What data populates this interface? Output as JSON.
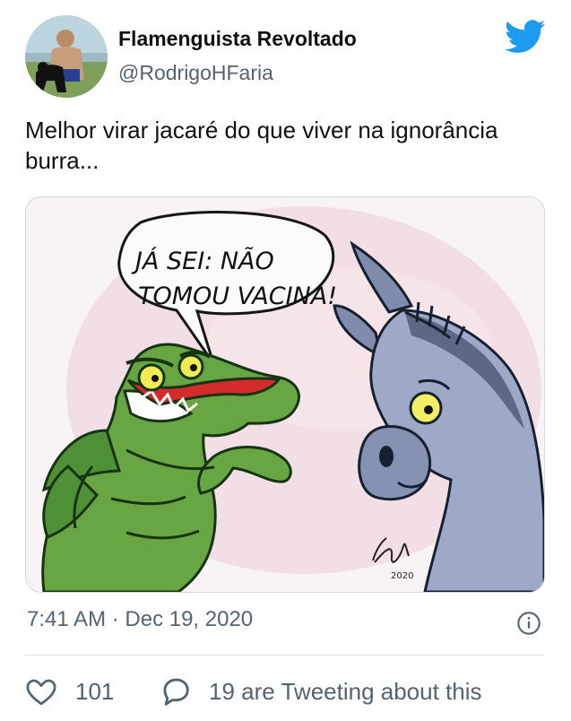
{
  "tweet": {
    "author_name": "Flamenguista Revoltado",
    "author_handle": "@RodrigoHFaria",
    "text": "Melhor virar jacaré do que viver na ignorância burra...",
    "timestamp": "7:41 AM · Dec 19, 2020",
    "brand_color": "#1d9bf0",
    "avatar_icon": "person-with-dog-photo",
    "media": {
      "description_icon": "cartoon-alligator-and-donkey",
      "speech_line_1": "JÁ SEI: NÃO",
      "speech_line_2": "TOMOU VACINA!",
      "signature": "2020"
    }
  },
  "actions": {
    "like_count": "101",
    "reply_text": "19 are Tweeting about this"
  }
}
